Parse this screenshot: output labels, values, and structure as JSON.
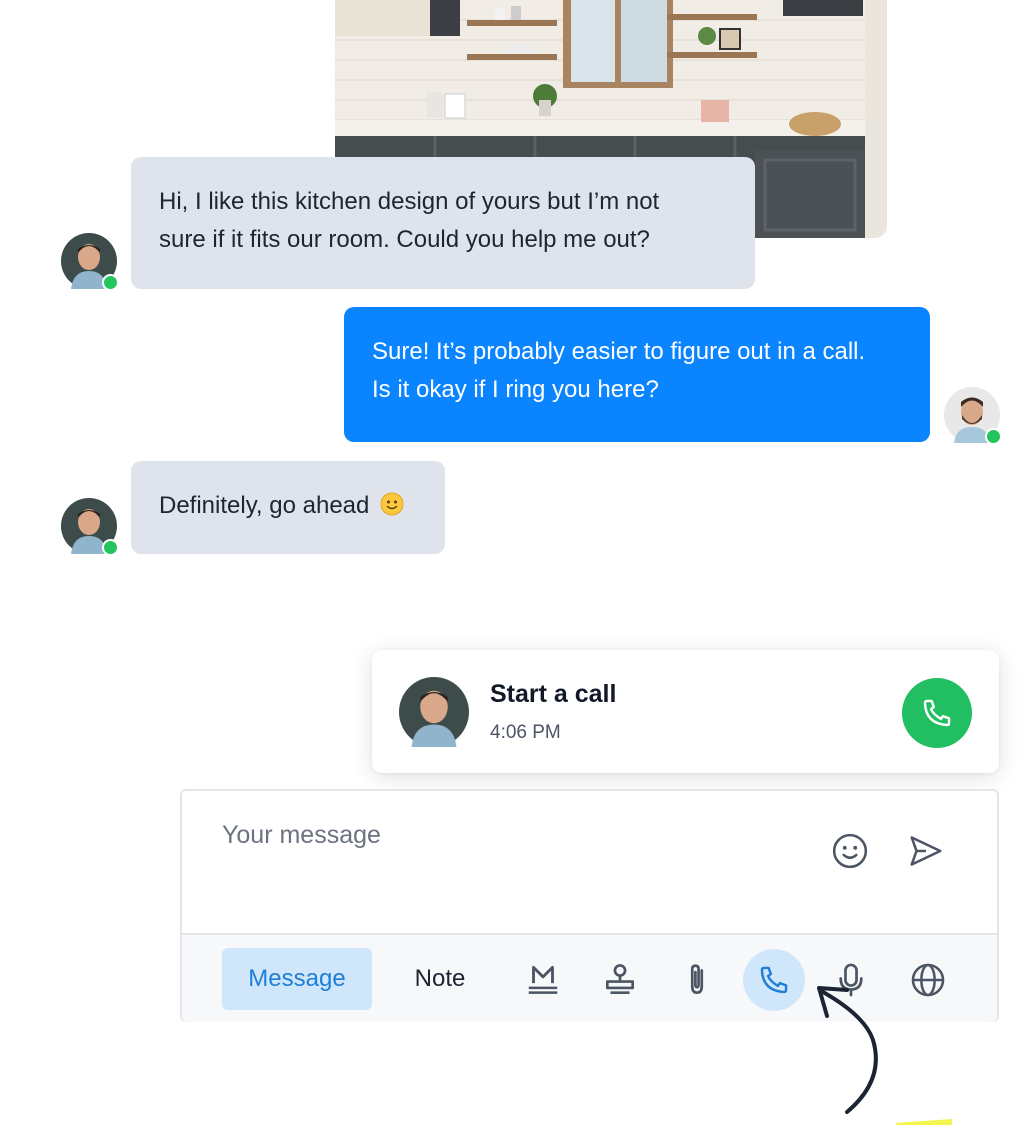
{
  "messages": [
    {
      "direction": "incoming",
      "line1": "Hi, I like this kitchen design of yours but I’m not",
      "line2": "sure if it fits our room. Could you help me out?"
    },
    {
      "direction": "outgoing",
      "line1": "Sure! It’s probably easier to figure out in a call.",
      "line2": "Is it okay if I ring you here?"
    },
    {
      "direction": "incoming",
      "text": "Definitely, go ahead",
      "emoji": "slightly-smiling-face"
    }
  ],
  "call_card": {
    "title": "Start a call",
    "time": "4:06 PM"
  },
  "composer": {
    "placeholder": "Your message",
    "tabs": {
      "message": "Message",
      "note": "Note"
    },
    "tools": [
      "markdown-icon",
      "stamp-icon",
      "paperclip-icon",
      "phone-icon",
      "microphone-icon",
      "globe-icon"
    ],
    "active_tool": "phone-icon"
  },
  "colors": {
    "incoming_bubble": "#dfe4ec",
    "outgoing_bubble": "#0a84ff",
    "online": "#22c55e",
    "call_button": "#22bf62",
    "active_tab": "#cfe6fb"
  }
}
